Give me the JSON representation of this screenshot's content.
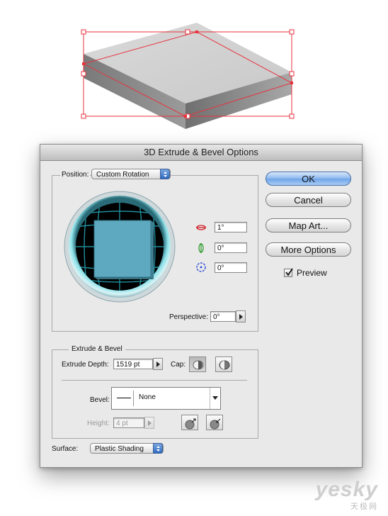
{
  "dialog": {
    "title": "3D Extrude & Bevel Options",
    "position_label": "Position:",
    "position_value": "Custom Rotation",
    "rotation_x": "1°",
    "rotation_y": "0°",
    "rotation_z": "0°",
    "perspective_label": "Perspective:",
    "perspective_value": "0°",
    "extrude_section_title": "Extrude & Bevel",
    "extrude_depth_label": "Extrude Depth:",
    "extrude_depth_value": "1519 pt",
    "cap_label": "Cap:",
    "bevel_label": "Bevel:",
    "bevel_value": "None",
    "height_label": "Height:",
    "height_value": "4 pt",
    "surface_label": "Surface:",
    "surface_value": "Plastic Shading",
    "buttons": {
      "ok": "OK",
      "cancel": "Cancel",
      "map_art": "Map Art...",
      "more_options": "More Options"
    },
    "preview_label": "Preview",
    "preview_checked": true
  },
  "icons": {
    "rotate_x": "rotate-x-axis-icon",
    "rotate_y": "rotate-y-axis-icon",
    "rotate_z": "rotate-z-axis-icon"
  },
  "colors": {
    "selection": "#e8323c",
    "cube_face": "#5ea9c0",
    "track_glow": "#7fd8e0"
  },
  "watermark": {
    "logo": "yesky",
    "sub": "天极网"
  }
}
